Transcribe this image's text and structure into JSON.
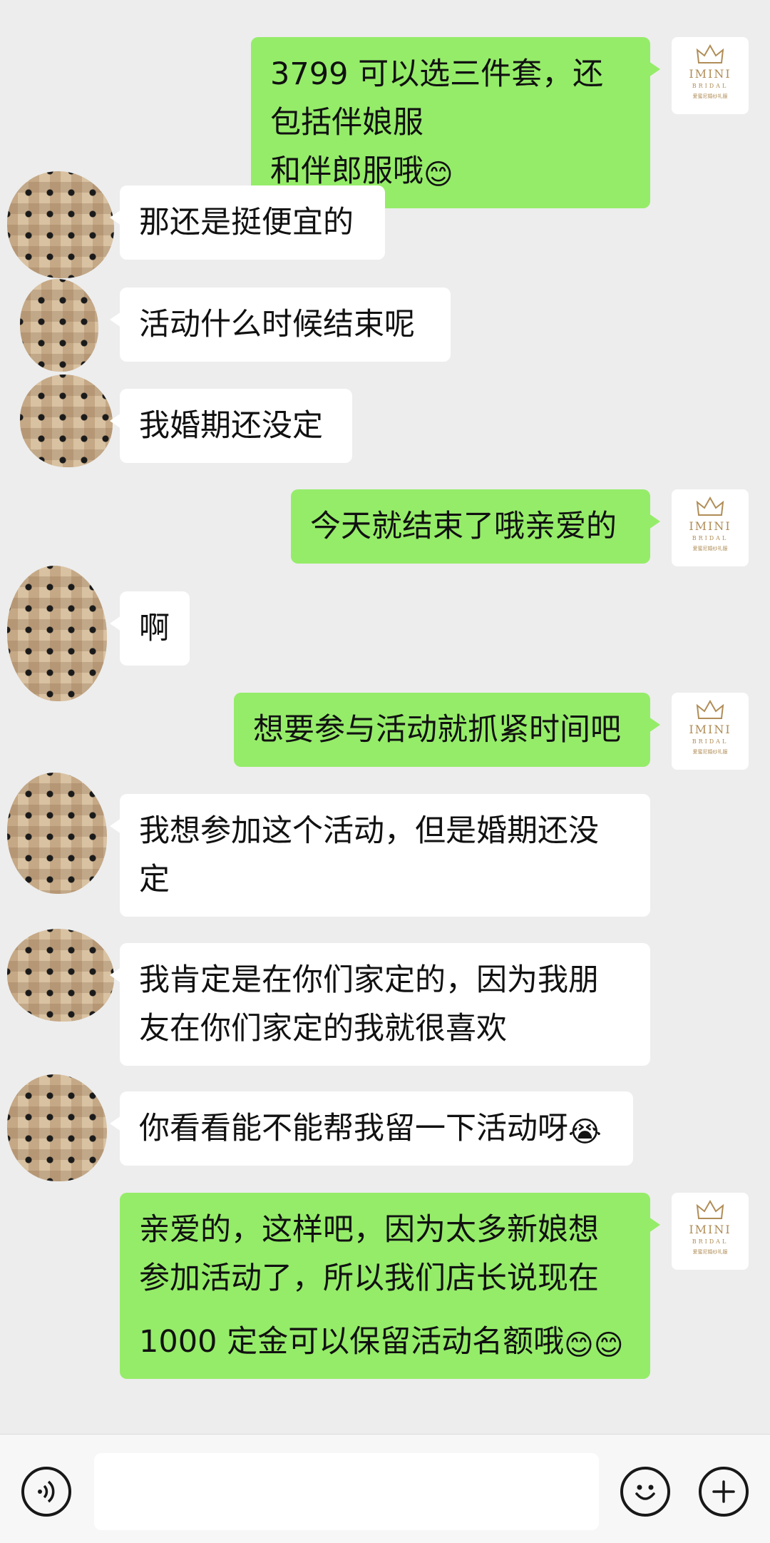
{
  "messages": [
    {
      "side": "out",
      "text": "3799 可以选三件套，还包括伴娘服\n和伴郎服哦",
      "emoji": "😊",
      "emoji2": ""
    },
    {
      "side": "in",
      "text": "那还是挺便宜的",
      "emoji": "",
      "emoji2": ""
    },
    {
      "side": "in",
      "text": "活动什么时候结束呢",
      "emoji": "",
      "emoji2": ""
    },
    {
      "side": "in",
      "text": "我婚期还没定",
      "emoji": "",
      "emoji2": ""
    },
    {
      "side": "out",
      "text": "今天就结束了哦亲爱的",
      "emoji": "",
      "emoji2": ""
    },
    {
      "side": "in",
      "text": "啊",
      "emoji": "",
      "emoji2": ""
    },
    {
      "side": "out",
      "text": "想要参与活动就抓紧时间吧",
      "emoji": "",
      "emoji2": ""
    },
    {
      "side": "in",
      "text": "我想参加这个活动，但是婚期还没\n定",
      "emoji": "",
      "emoji2": ""
    },
    {
      "side": "in",
      "text": "我肯定是在你们家定的，因为我朋\n友在你们家定的我就很喜欢",
      "emoji": "",
      "emoji2": ""
    },
    {
      "side": "in",
      "text": "你看看能不能帮我留一下活动呀",
      "emoji": "😭",
      "emoji2": ""
    },
    {
      "side": "out",
      "text": "亲爱的，这样吧，因为太多新娘想\n参加活动了，所以我们店长说现在\n1000 定金可以保留活动名额哦",
      "emoji": "😊",
      "emoji2": "\n😊"
    }
  ],
  "merchant_avatar": {
    "brand": "IMINI",
    "sub": "BRIDAL",
    "cn": "爱蜜尼婚纱礼服"
  },
  "input_bar": {
    "voice_icon": "voice-icon",
    "emoji_icon": "smiley-icon",
    "plus_icon": "plus-icon",
    "input_value": ""
  },
  "colors": {
    "outgoing_bubble": "#95ec69",
    "incoming_bubble": "#ffffff",
    "background": "#ededed",
    "brand_gold": "#b08d57"
  }
}
